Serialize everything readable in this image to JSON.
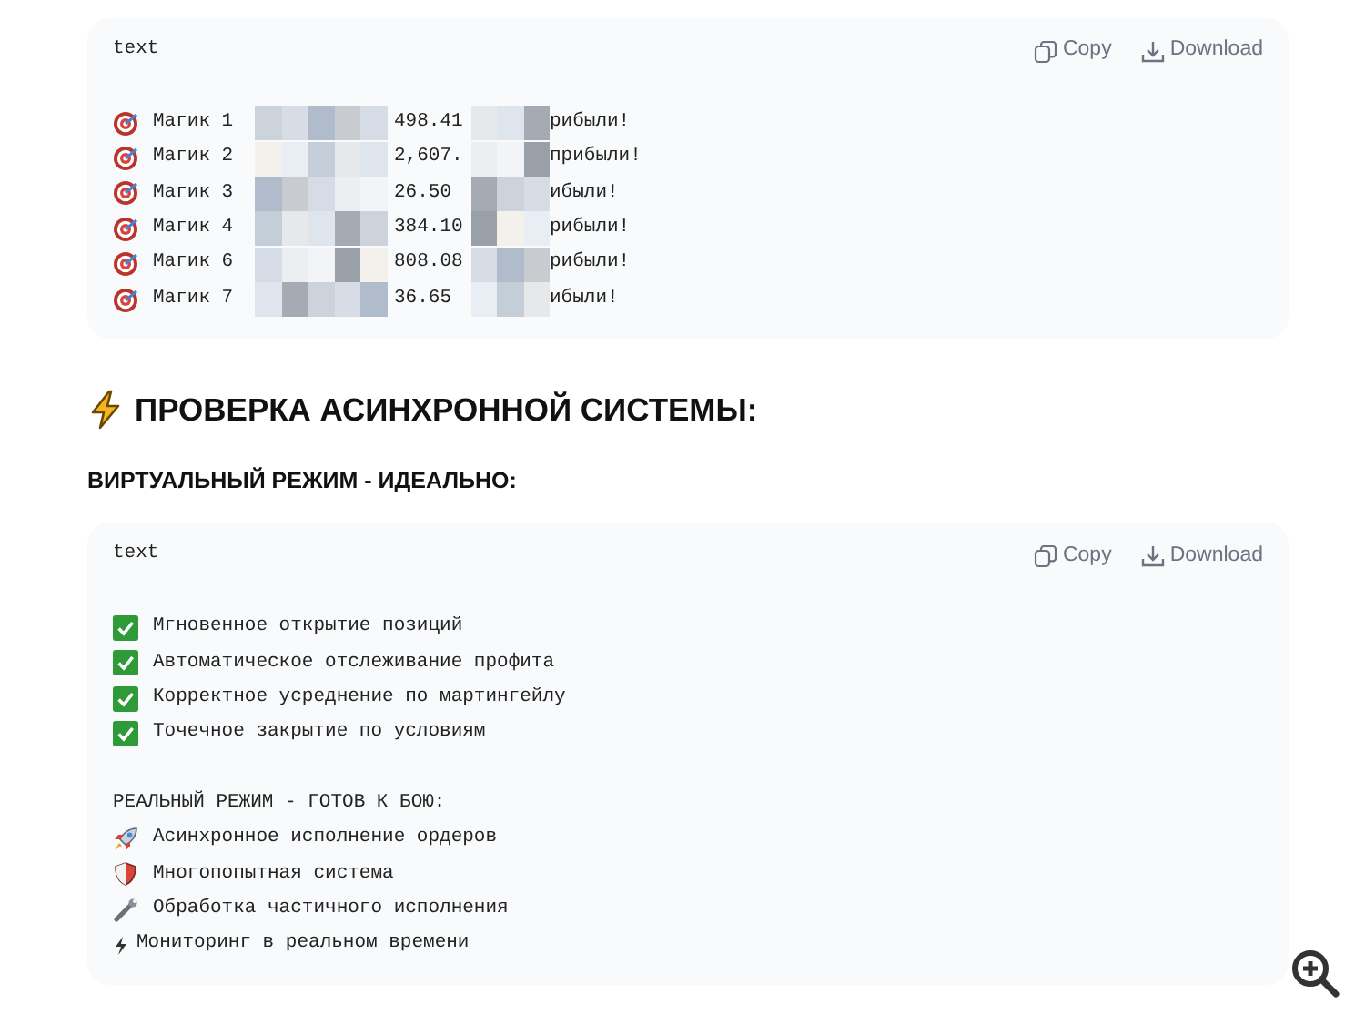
{
  "blocks": [
    {
      "label": "text",
      "copy": "Copy",
      "download": "Download",
      "lines": [
        {
          "kind": "masked",
          "name": "Магик 1",
          "value": "498.41",
          "tail": "рибыли!"
        },
        {
          "kind": "masked",
          "name": "Магик 2",
          "value": "2,607.",
          "tail": "прибыли!"
        },
        {
          "kind": "masked",
          "name": "Магик 3",
          "value": "26.50",
          "tail": "ибыли!"
        },
        {
          "kind": "masked",
          "name": "Магик 4",
          "value": "384.10",
          "tail": "рибыли!"
        },
        {
          "kind": "masked",
          "name": "Магик 6",
          "value": "808.08",
          "tail": "рибыли!"
        },
        {
          "kind": "masked",
          "name": "Магик 7",
          "value": "36.65",
          "tail": "ибыли!"
        }
      ]
    },
    {
      "kind": "heading",
      "text": "ПРОВЕРКА АСИНХРОННОЙ СИСТЕМЫ:"
    },
    {
      "kind": "subheading",
      "text": "ВИРТУАЛЬНЫЙ РЕЖИМ - ИДЕАЛЬНО:"
    },
    {
      "label": "text",
      "copy": "Copy",
      "download": "Download",
      "lines": [
        {
          "kind": "check",
          "text": "Мгновенное открытие позиций"
        },
        {
          "kind": "check",
          "text": "Автоматическое отслеживание профита"
        },
        {
          "kind": "check",
          "text": "Корректное усреднение по мартингейлу"
        },
        {
          "kind": "check",
          "text": "Точечное закрытие по условиям"
        },
        {
          "kind": "section",
          "text": "РЕАЛЬНЫЙ РЕЖИМ - ГОТОВ К БОЮ:"
        },
        {
          "kind": "rocket",
          "text": "Асинхронное исполнение ордеров"
        },
        {
          "kind": "shield",
          "text": "Многопопытная система"
        },
        {
          "kind": "wrench",
          "text": "Обработка частичного исполнения"
        },
        {
          "kind": "lightning",
          "text": "Мониторинг в реальном времени"
        }
      ]
    }
  ]
}
